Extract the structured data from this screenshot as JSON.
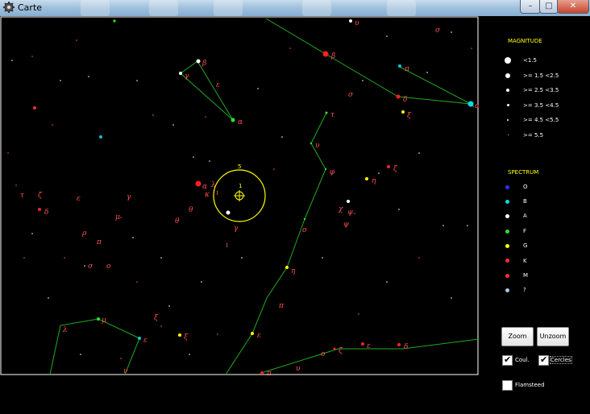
{
  "window": {
    "title": "Carte",
    "min_label": "–",
    "max_label": "□",
    "close_label": "✕"
  },
  "legend": {
    "magnitude_title": "MAGNITUDE",
    "magnitude_items": [
      {
        "label": "<1.5"
      },
      {
        "label": ">= 1.5 <2.5"
      },
      {
        "label": ">= 2.5 <3.5"
      },
      {
        "label": ">= 3.5 <4.5"
      },
      {
        "label": ">= 4.5 <5.5"
      },
      {
        "label": ">= 5.5"
      }
    ],
    "spectrum_title": "SPECTRUM",
    "spectrum_items": [
      {
        "label": "O",
        "color": "#3030ff"
      },
      {
        "label": "B",
        "color": "#00e0e0"
      },
      {
        "label": "A",
        "color": "#ffffff"
      },
      {
        "label": "F",
        "color": "#30e030"
      },
      {
        "label": "G",
        "color": "#ffff00"
      },
      {
        "label": "K",
        "color": "#ff3030"
      },
      {
        "label": "M",
        "color": "#ff3030"
      },
      {
        "label": "?",
        "color": "#a8c8e8"
      }
    ]
  },
  "controls": {
    "zoom_label": "Zoom",
    "unzoom_label": "Unzoom",
    "coul_label": "Coul.",
    "coul_checked": true,
    "cercles_label": "Cercles",
    "cercles_checked": true,
    "flamsteed_label": "Flamsteed",
    "flamsteed_checked": false
  },
  "map": {
    "reticle_outer_label": "5",
    "reticle_inner_label": "1",
    "star_labels": [
      {
        "text": "υ"
      },
      {
        "text": "σ"
      },
      {
        "text": "β"
      },
      {
        "text": "π"
      },
      {
        "text": "σ"
      },
      {
        "text": "δ"
      },
      {
        "text": "α"
      },
      {
        "text": "ξ"
      },
      {
        "text": "β"
      },
      {
        "text": "γ"
      },
      {
        "text": "ε"
      },
      {
        "text": "α"
      },
      {
        "text": "τ"
      },
      {
        "text": "υ"
      },
      {
        "text": "φ"
      },
      {
        "text": "η"
      },
      {
        "text": "ζ"
      },
      {
        "text": "λ"
      },
      {
        "text": "α"
      },
      {
        "text": "κ"
      },
      {
        "text": "θ"
      },
      {
        "text": "ι"
      },
      {
        "text": "γ"
      },
      {
        "text": "χ"
      },
      {
        "text": "ψ"
      },
      {
        "text": "ψ"
      },
      {
        "text": "ο"
      },
      {
        "text": "τ"
      },
      {
        "text": "ζ"
      },
      {
        "text": "ε"
      },
      {
        "text": "γ"
      },
      {
        "text": "δ"
      },
      {
        "text": "μ"
      },
      {
        "text": "θ"
      },
      {
        "text": "ρ"
      },
      {
        "text": "π"
      },
      {
        "text": "σ"
      },
      {
        "text": "ο"
      },
      {
        "text": "ι"
      },
      {
        "text": "η"
      },
      {
        "text": "π"
      },
      {
        "text": "ε"
      },
      {
        "text": "λ"
      },
      {
        "text": "μ"
      },
      {
        "text": "ε"
      },
      {
        "text": "ξ"
      },
      {
        "text": "ξ"
      },
      {
        "text": "ν"
      },
      {
        "text": "ο"
      },
      {
        "text": "ζ"
      },
      {
        "text": "ε"
      },
      {
        "text": "δ"
      },
      {
        "text": "υ"
      },
      {
        "text": "π"
      }
    ]
  }
}
